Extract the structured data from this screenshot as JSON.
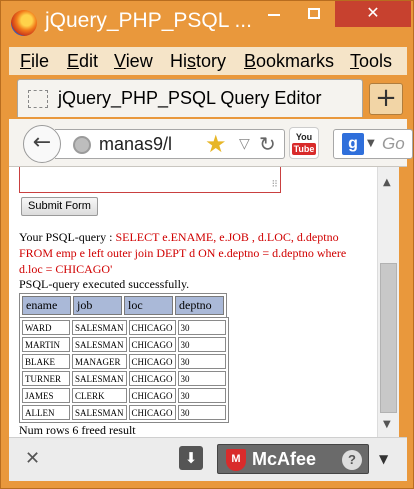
{
  "window": {
    "title": "jQuery_PHP_PSQL ...",
    "min_icon": "minimize-icon",
    "max_icon": "maximize-icon",
    "close_label": "✕"
  },
  "menu": {
    "items": [
      {
        "pre": "",
        "u": "F",
        "post": "ile"
      },
      {
        "pre": "",
        "u": "E",
        "post": "dit"
      },
      {
        "pre": "",
        "u": "V",
        "post": "iew"
      },
      {
        "pre": "Hi",
        "u": "s",
        "post": "tory"
      },
      {
        "pre": "",
        "u": "B",
        "post": "ookmarks"
      },
      {
        "pre": "",
        "u": "T",
        "post": "ools"
      }
    ]
  },
  "tab": {
    "label": "jQuery_PHP_PSQL Query Editor",
    "new_tab": "+"
  },
  "nav": {
    "back": "←",
    "url": "manas9/l",
    "star": "★",
    "dropdown": "▽",
    "reload": "↻",
    "youtube_top": "You",
    "youtube_bottom": "Tube",
    "search_engine": "g",
    "search_arrow": "▼",
    "search_placeholder": "Go"
  },
  "content": {
    "grip": "⠿",
    "submit_label": "Submit Form",
    "query_prefix": "Your PSQL-query : ",
    "query_text": "SELECT e.ENAME, e.JOB , d.LOC, d.deptno FROM emp e left outer join DEPT d ON e.deptno = d.deptno where d.loc = CHICAGO'",
    "exec_msg": "PSQL-query executed successfully.",
    "headers": [
      "ename",
      "job",
      "loc",
      "deptno"
    ],
    "rows": [
      [
        "WARD",
        "SALESMAN",
        "CHICAGO",
        "30"
      ],
      [
        "MARTIN",
        "SALESMAN",
        "CHICAGO",
        "30"
      ],
      [
        "BLAKE",
        "MANAGER",
        "CHICAGO",
        "30"
      ],
      [
        "TURNER",
        "SALESMAN",
        "CHICAGO",
        "30"
      ],
      [
        "JAMES",
        "CLERK",
        "CHICAGO",
        "30"
      ],
      [
        "ALLEN",
        "SALESMAN",
        "CHICAGO",
        "30"
      ]
    ],
    "numrows": "Num rows 6 freed result"
  },
  "scroll": {
    "up": "▲",
    "down": "▼"
  },
  "bottom": {
    "close": "✕",
    "download": "⬇",
    "mcafee_label": "McAfee",
    "mcafee_mark": "M",
    "help": "?",
    "menu_arrow": "▼"
  },
  "colors": {
    "frame": "#e9983c",
    "close_button": "#c7412f",
    "query_red": "#d00000",
    "header_cell": "#aab9d8"
  }
}
